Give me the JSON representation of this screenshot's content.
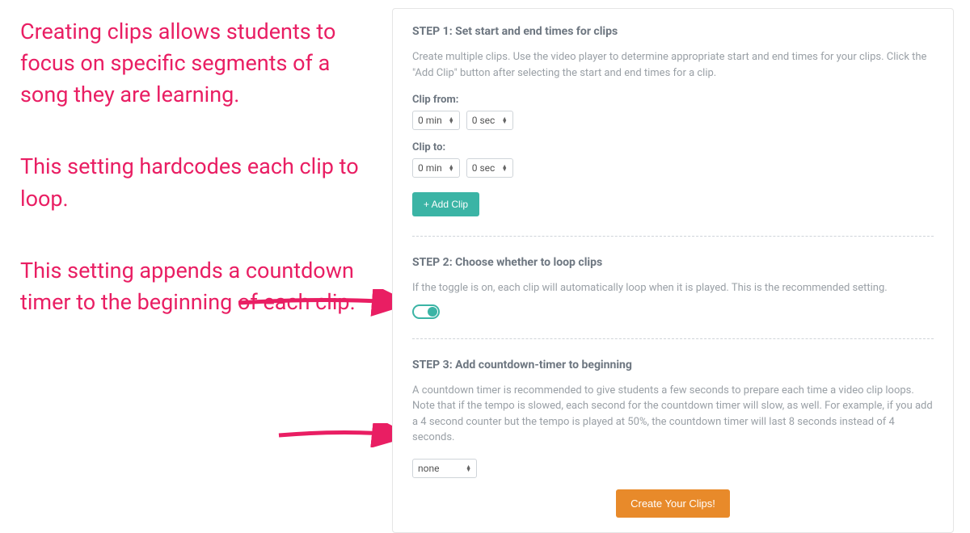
{
  "annotations": {
    "a1": "Creating clips allows students to focus on specific segments of a song they are learning.",
    "a2": "This setting hardcodes each clip to loop.",
    "a3": "This setting appends a countdown timer to the beginning of each clip."
  },
  "panel": {
    "step1": {
      "title": "STEP 1: Set start and end times for clips",
      "desc": "Create multiple clips. Use the video player to determine appropriate start and end times for your clips. Click the \"Add Clip\" button after selecting the start and end times for a clip.",
      "from_label": "Clip from:",
      "from_min": "0 min",
      "from_sec": "0 sec",
      "to_label": "Clip to:",
      "to_min": "0 min",
      "to_sec": "0 sec",
      "add_clip": "+ Add Clip"
    },
    "step2": {
      "title": "STEP 2: Choose whether to loop clips",
      "desc": "If the toggle is on, each clip will automatically loop when it is played. This is the recommended setting.",
      "toggle_on": true
    },
    "step3": {
      "title": "STEP 3: Add countdown-timer to beginning",
      "desc": "A countdown timer is recommended to give students a few seconds to prepare each time a video clip loops. Note that if the tempo is slowed, each second for the countdown timer will slow, as well. For example, if you add a 4 second counter but the tempo is played at 50%, the countdown timer will last 8 seconds instead of 4 seconds.",
      "select_value": "none",
      "create_button": "Create Your Clips!"
    }
  },
  "colors": {
    "annotation": "#e91e63",
    "teal": "#3bb4a5",
    "orange": "#e88a2a"
  }
}
